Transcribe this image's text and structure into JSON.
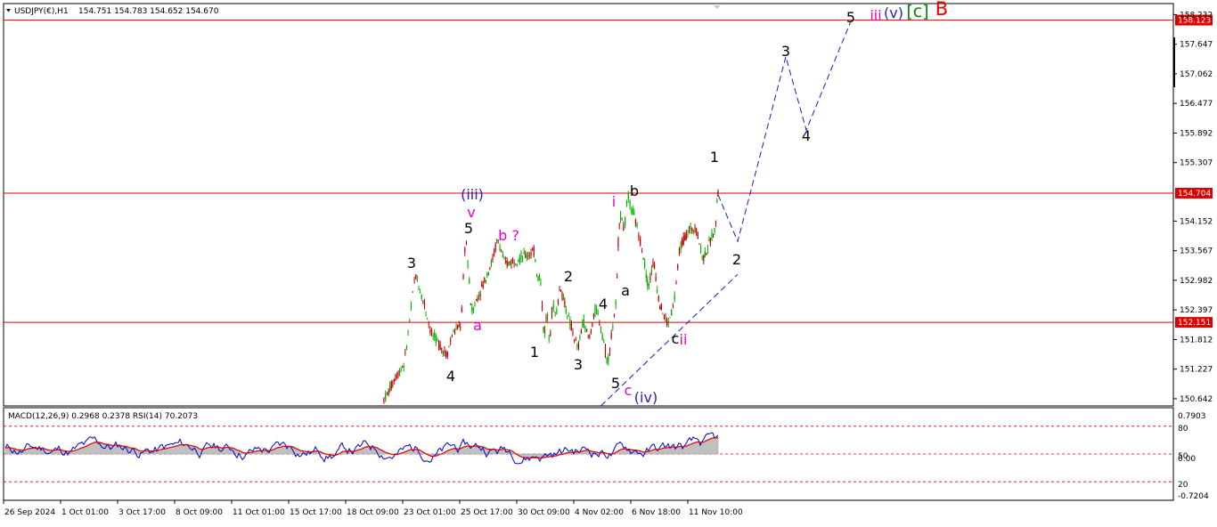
{
  "header": {
    "symbol_label": "USDJPY(€),H1",
    "ohlc": "154.751 154.783 154.652 154.670",
    "indicator_label": "MACD(12,26,9) 0.2968 0.2378  RSI(14) 70.2073"
  },
  "price_axis": {
    "ticks": [
      "158.232",
      "157.647",
      "157.062",
      "156.477",
      "155.892",
      "155.307",
      "154.152",
      "153.567",
      "152.982",
      "152.397",
      "151.812",
      "151.227",
      "150.642"
    ],
    "levels": [
      {
        "label": "158.123",
        "value": 158.123
      },
      {
        "label": "154.704",
        "value": 154.704
      },
      {
        "label": "152.151",
        "value": 152.151
      }
    ]
  },
  "indicator_axis": {
    "ticks": [
      "0.7903",
      "80",
      "50",
      "0.00",
      "20",
      "-0.7204"
    ]
  },
  "time_axis": {
    "labels": [
      "26 Sep 2024",
      "1 Oct 01:00",
      "3 Oct 17:00",
      "8 Oct 09:00",
      "11 Oct 01:00",
      "15 Oct 17:00",
      "18 Oct 09:00",
      "23 Oct 01:00",
      "25 Oct 17:00",
      "30 Oct 09:00",
      "4 Nov 02:00",
      "6 Nov 18:00",
      "11 Nov 10:00"
    ]
  },
  "colors": {
    "bull": "#00b000",
    "bear": "#c00000",
    "level_line": "#dd0000",
    "projection": "#1a1acc",
    "macd_hist": "#c0c0c0",
    "signal": "#e00000",
    "rsi": "#0000cc",
    "wave_black": "#000000",
    "wave_magenta": "#ee00cc",
    "wave_blue": "#2222cc",
    "wave_green": "#008800",
    "wave_red": "#ee0000"
  },
  "wave_labels": [
    {
      "text": "3",
      "color": "black",
      "x_date": "22 Oct",
      "price": 153.35
    },
    {
      "text": "4",
      "color": "black",
      "x_date": "23 Oct",
      "price": 151.55
    },
    {
      "text": "a",
      "color": "magenta",
      "x_date": "24 Oct",
      "price": 152.25
    },
    {
      "text": "5",
      "color": "black",
      "x_date": "24 Oct",
      "price": 154.1
    },
    {
      "text": "v",
      "color": "magenta",
      "x_date": "24 Oct",
      "price": 154.35
    },
    {
      "text": "(iii)",
      "color": "blue",
      "x_date": "24 Oct",
      "price": 154.8
    },
    {
      "text": "b ?",
      "color": "magenta",
      "x_date": "25 Oct",
      "price": 153.95
    },
    {
      "text": "1",
      "color": "black",
      "x_date": "28 Oct",
      "price": 151.7
    },
    {
      "text": "2",
      "color": "black",
      "x_date": "31 Oct",
      "price": 153.1
    },
    {
      "text": "3",
      "color": "black",
      "x_date": "1 Nov",
      "price": 151.5
    },
    {
      "text": "4",
      "color": "black",
      "x_date": "1 Nov",
      "price": 152.55
    },
    {
      "text": "5",
      "color": "black",
      "x_date": "4 Nov",
      "price": 151.1
    },
    {
      "text": "c",
      "color": "magenta",
      "x_date": "4 Nov",
      "price": 151.0
    },
    {
      "text": "(iv)",
      "color": "blue",
      "x_date": "4 Nov",
      "price": 150.9
    },
    {
      "text": "i",
      "color": "magenta",
      "x_date": "5 Nov",
      "price": 154.6
    },
    {
      "text": "a",
      "color": "black",
      "x_date": "5 Nov",
      "price": 152.75
    },
    {
      "text": "b",
      "color": "black",
      "x_date": "6 Nov",
      "price": 154.82
    },
    {
      "text": "c",
      "color": "black",
      "x_date": "7 Nov",
      "price": 151.92
    },
    {
      "text": "ii",
      "color": "magenta",
      "x_date": "7 Nov",
      "price": 151.9
    },
    {
      "text": "1",
      "color": "black",
      "x_date": "11 Nov",
      "price": 155.45
    },
    {
      "text": "2",
      "color": "black",
      "x_date": "12 Nov",
      "price": 153.6
    },
    {
      "text": "3",
      "color": "black",
      "x_date": "13 Nov",
      "price": 157.5
    },
    {
      "text": "4",
      "color": "black",
      "x_date": "14 Nov",
      "price": 155.9
    },
    {
      "text": "5",
      "color": "black",
      "x_date": "15 Nov",
      "price": 158.32
    },
    {
      "text": "iii",
      "color": "magenta",
      "x_date": "15 Nov",
      "price": 158.32
    },
    {
      "text": "(v)",
      "color": "blue",
      "x_date": "15 Nov",
      "price": 158.36
    },
    {
      "text": "[c]",
      "color": "green",
      "x_date": "15 Nov",
      "price": 158.36
    },
    {
      "text": "B",
      "color": "red",
      "x_date": "15 Nov",
      "price": 158.4
    }
  ],
  "chart_data": {
    "type": "candlestick",
    "symbol": "USDJPY(€)",
    "timeframe": "H1",
    "ylim": [
      150.5,
      158.45
    ],
    "horizontal_levels": [
      158.123,
      154.704,
      152.151
    ],
    "last_bar": {
      "open": 154.751,
      "high": 154.783,
      "low": 154.652,
      "close": 154.67
    },
    "price_path": [
      {
        "x": "21 Oct 09:00",
        "close": 150.62
      },
      {
        "x": "21 Oct 14:00",
        "close": 150.75
      },
      {
        "x": "21 Oct 21:00",
        "close": 151.05
      },
      {
        "x": "22 Oct 07:00",
        "close": 151.35
      },
      {
        "x": "22 Oct 13:00",
        "close": 152.3
      },
      {
        "x": "22 Oct 18:00",
        "close": 153.1
      },
      {
        "x": "23 Oct 01:00",
        "close": 152.45
      },
      {
        "x": "23 Oct 05:00",
        "close": 151.95
      },
      {
        "x": "23 Oct 10:00",
        "close": 151.75
      },
      {
        "x": "23 Oct 16:00",
        "close": 151.5
      },
      {
        "x": "23 Oct 21:00",
        "close": 151.95
      },
      {
        "x": "24 Oct 04:00",
        "close": 152.1
      },
      {
        "x": "24 Oct 08:00",
        "close": 153.9
      },
      {
        "x": "24 Oct 13:00",
        "close": 152.35
      },
      {
        "x": "25 Oct 01:00",
        "close": 153.0
      },
      {
        "x": "25 Oct 07:00",
        "close": 153.35
      },
      {
        "x": "25 Oct 12:00",
        "close": 153.8
      },
      {
        "x": "25 Oct 20:00",
        "close": 153.3
      },
      {
        "x": "28 Oct 02:00",
        "close": 153.55
      },
      {
        "x": "28 Oct 09:00",
        "close": 153.0
      },
      {
        "x": "28 Oct 15:00",
        "close": 153.1
      },
      {
        "x": "29 Oct 01:00",
        "close": 151.85
      },
      {
        "x": "29 Oct 07:00",
        "close": 152.35
      },
      {
        "x": "29 Oct 14:00",
        "close": 151.8
      },
      {
        "x": "29 Oct 21:00",
        "close": 152.55
      },
      {
        "x": "30 Oct 05:00",
        "close": 152.25
      },
      {
        "x": "30 Oct 12:00",
        "close": 152.9
      },
      {
        "x": "30 Oct 18:00",
        "close": 152.45
      },
      {
        "x": "31 Oct 02:00",
        "close": 152.0
      },
      {
        "x": "31 Oct 09:00",
        "close": 151.6
      },
      {
        "x": "31 Oct 15:00",
        "close": 152.2
      },
      {
        "x": "31 Oct 22:00",
        "close": 151.8
      },
      {
        "x": "1 Nov 06:00",
        "close": 152.45
      },
      {
        "x": "1 Nov 13:00",
        "close": 152.0
      },
      {
        "x": "1 Nov 20:00",
        "close": 151.35
      },
      {
        "x": "4 Nov 03:00",
        "close": 152.6
      },
      {
        "x": "4 Nov 08:00",
        "close": 154.1
      },
      {
        "x": "4 Nov 13:00",
        "close": 154.3
      },
      {
        "x": "4 Nov 20:00",
        "close": 153.95
      },
      {
        "x": "5 Nov 03:00",
        "close": 154.65
      },
      {
        "x": "5 Nov 10:00",
        "close": 154.45
      },
      {
        "x": "5 Nov 17:00",
        "close": 154.1
      },
      {
        "x": "6 Nov 01:00",
        "close": 153.55
      },
      {
        "x": "6 Nov 08:00",
        "close": 152.85
      },
      {
        "x": "6 Nov 15:00",
        "close": 153.35
      },
      {
        "x": "6 Nov 22:00",
        "close": 152.55
      },
      {
        "x": "7 Nov 06:00",
        "close": 152.1
      },
      {
        "x": "7 Nov 12:00",
        "close": 152.5
      },
      {
        "x": "7 Nov 18:00",
        "close": 153.65
      },
      {
        "x": "8 Nov 02:00",
        "close": 153.95
      },
      {
        "x": "8 Nov 09:00",
        "close": 154.05
      },
      {
        "x": "8 Nov 16:00",
        "close": 153.4
      },
      {
        "x": "11 Nov 00:00",
        "close": 154.0
      },
      {
        "x": "11 Nov 06:00",
        "close": 154.3
      },
      {
        "x": "11 Nov 11:00",
        "close": 154.78
      },
      {
        "x": "11 Nov 13:00",
        "close": 154.67
      }
    ],
    "projection_path": [
      {
        "x": "12 Nov",
        "price": 153.75
      },
      {
        "x": "13 Nov",
        "price": 157.4
      },
      {
        "x": "14 Nov",
        "price": 155.95
      },
      {
        "x": "15 Nov",
        "price": 158.1
      }
    ],
    "trendline": [
      {
        "x": "1 Nov",
        "price": 150.5
      },
      {
        "x": "12 Nov",
        "price": 153.1
      }
    ],
    "indicators": {
      "macd": {
        "params": "12,26,9",
        "main": 0.2968,
        "signal": 0.2378
      },
      "rsi": {
        "period": 14,
        "value": 70.2073,
        "levels": [
          80,
          50,
          20
        ]
      }
    }
  }
}
